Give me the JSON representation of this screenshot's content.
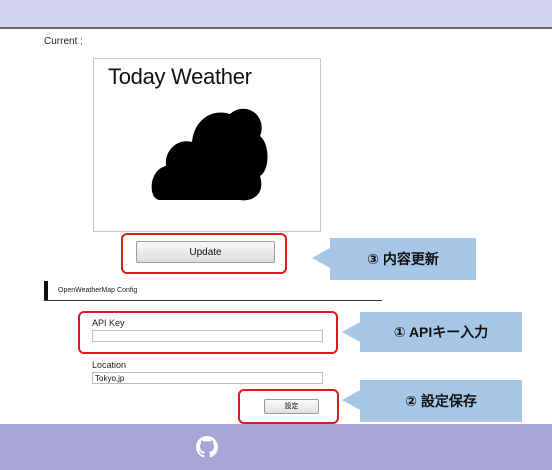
{
  "current": {
    "label": "Current :"
  },
  "preview": {
    "title": "Today Weather",
    "weather_icon": "cloud-icon"
  },
  "update_button": {
    "label": "Update"
  },
  "section": {
    "title": "OpenWeatherMap Config"
  },
  "api_key": {
    "label": "API Key",
    "value": ""
  },
  "location": {
    "label": "Location",
    "value": "Tokyo,jp"
  },
  "save_button": {
    "label": "設定"
  },
  "callouts": {
    "update": "③ 内容更新",
    "api_key": "① APIキー入力",
    "save": "② 設定保存"
  },
  "footer": {
    "icon": "github-icon"
  },
  "colors": {
    "topbar": "#d4d2f2",
    "footer": "#a7a6d6",
    "highlight": "#e0191f",
    "callout": "#a7c7e7"
  }
}
